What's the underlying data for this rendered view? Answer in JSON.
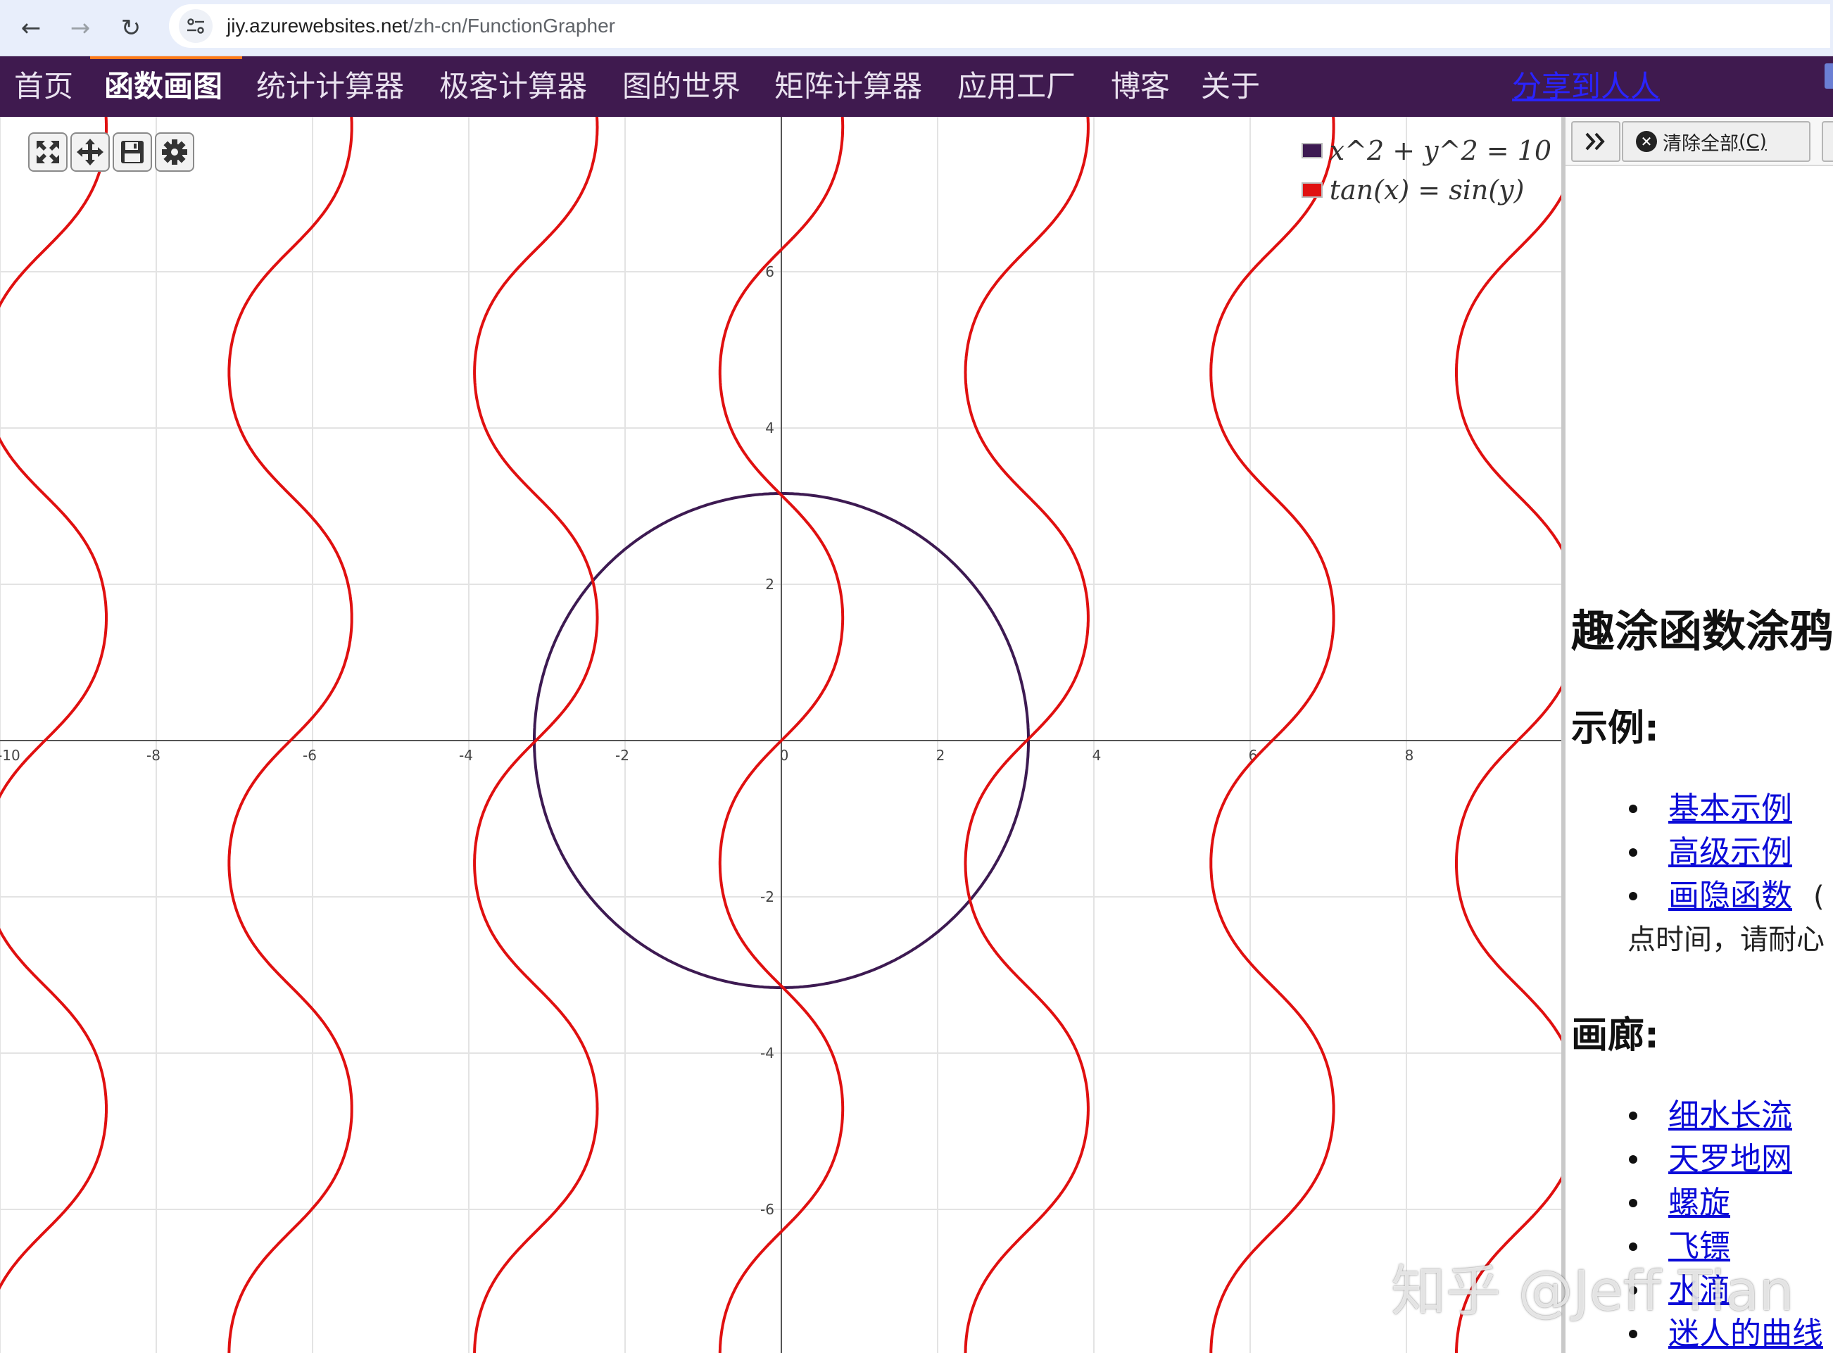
{
  "browser": {
    "url_host": "jiy.azurewebsites.net",
    "url_path": "/zh-cn/FunctionGrapher"
  },
  "nav": {
    "items": [
      {
        "label": "首页",
        "active": false
      },
      {
        "label": "函数画图",
        "active": true
      },
      {
        "label": "统计计算器",
        "active": false
      },
      {
        "label": "极客计算器",
        "active": false
      },
      {
        "label": "图的世界",
        "active": false
      },
      {
        "label": "矩阵计算器",
        "active": false
      },
      {
        "label": "应用工厂",
        "active": false
      },
      {
        "label": "博客",
        "active": false
      },
      {
        "label": "关于",
        "active": false
      }
    ],
    "share_label": "分享到人人"
  },
  "graph": {
    "x_range": [
      -10,
      10
    ],
    "y_range": [
      -8,
      8
    ],
    "x_ticks": [
      -10,
      -8,
      -6,
      -4,
      -2,
      0,
      2,
      4,
      6,
      8
    ],
    "y_ticks": [
      -6,
      -4,
      -2,
      2,
      4,
      6
    ],
    "grid": true,
    "functions": [
      {
        "label": "x^2 + y^2 = 10",
        "color": "#3d1a52",
        "type": "circle",
        "radius_squared": 10
      },
      {
        "label": "tan(x) = sin(y)",
        "color": "#e01010",
        "type": "implicit-tan-sin"
      }
    ],
    "colors": {
      "axis": "#555555",
      "grid": "#e3e3e3",
      "tick_label": "#444444"
    }
  },
  "panel": {
    "clear_label": "清除全部",
    "clear_key": "(C)",
    "title": "趣涂函数涂鸦",
    "examples_heading": "示例:",
    "examples": [
      {
        "label": "基本示例"
      },
      {
        "label": "高级示例"
      },
      {
        "label": "画隐函数",
        "note": "(",
        "note_cont": "点时间，请耐心"
      }
    ],
    "gallery_heading": "画廊:",
    "gallery": [
      {
        "label": "细水长流"
      },
      {
        "label": "天罗地网"
      },
      {
        "label": "螺旋"
      },
      {
        "label": "飞镖"
      },
      {
        "label": "水滴"
      },
      {
        "label": "迷人的曲线"
      }
    ]
  },
  "watermark": "知乎 @Jeff Tian"
}
